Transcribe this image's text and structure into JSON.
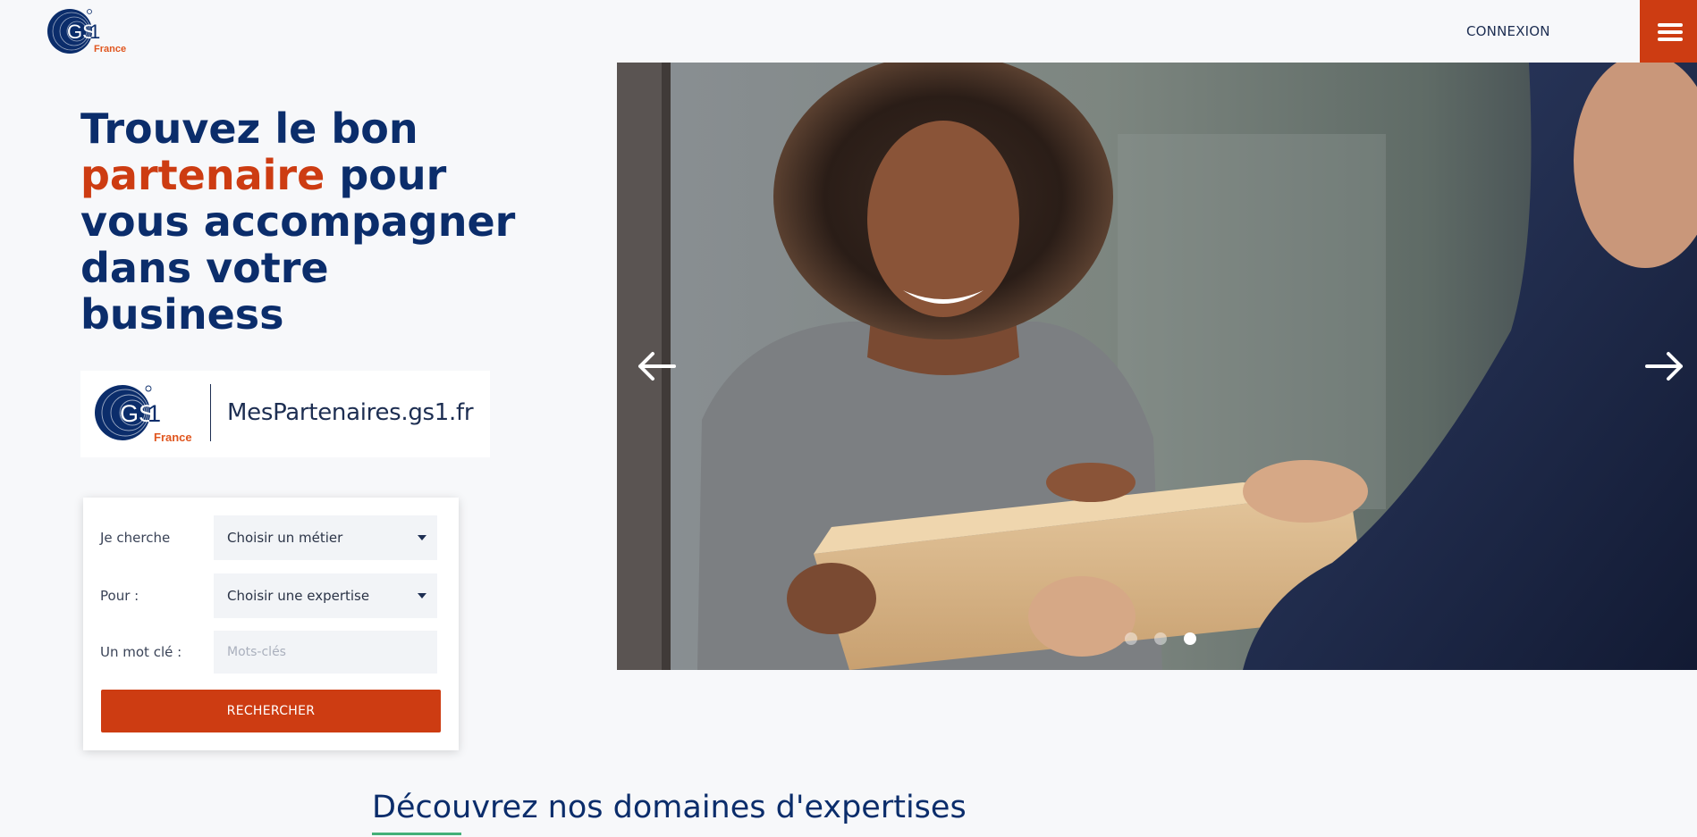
{
  "header": {
    "logo_text": "GS1",
    "logo_sub": "France",
    "connexion_label": "CONNEXION",
    "menu_icon": "hamburger-icon",
    "menu_color": "#cd3c12"
  },
  "hero": {
    "title_part1": "Trouvez le bon",
    "title_accent": "partenaire",
    "title_part2": "pour vous accompagner dans votre business",
    "accent_color": "#cd3c12",
    "title_color": "#0b2d6b"
  },
  "partners_banner": {
    "logo_text": "GS1",
    "logo_sub": "France",
    "site_name": "MesPartenaires.gs1.fr"
  },
  "search": {
    "fields": [
      {
        "label": "Je cherche",
        "value": "Choisir un métier"
      },
      {
        "label": "Pour :",
        "value": "Choisir une expertise"
      },
      {
        "label": "Un mot clé :",
        "placeholder": "Mots-clés"
      }
    ],
    "button_label": "RECHERCHER",
    "button_color": "#cd3c12"
  },
  "carousel": {
    "prev_icon": "arrow-left-icon",
    "next_icon": "arrow-right-icon",
    "slide_count": 3,
    "active_slide": 3
  },
  "section": {
    "title": "Découvrez nos domaines d'expertises",
    "underline_color": "#44b078"
  }
}
